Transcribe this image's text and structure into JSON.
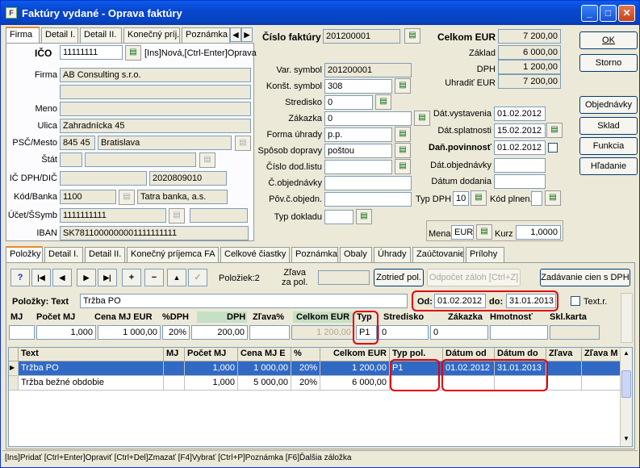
{
  "window": {
    "title": "Faktúry vydané - Oprava faktúry",
    "min": "_",
    "max": "□",
    "close": "✕"
  },
  "top_tabs": [
    "Firma",
    "Detail I.",
    "Detail II.",
    "Konečný príj.",
    "Poznámka"
  ],
  "firma": {
    "ico_label": "IČO",
    "ico": "11111111",
    "ico_hint": "[Ins]Nová,[Ctrl-Enter]Oprava",
    "firma_label": "Firma",
    "firma": "AB Consulting s.r.o.",
    "meno_label": "Meno",
    "ulica_label": "Ulica",
    "ulica": "Zahradnícka 45",
    "psc_label": "PSČ/Mesto",
    "psc": "845 45",
    "mesto": "Bratislava",
    "stat_label": "Štát",
    "icdph_label": "IČ DPH/DIČ",
    "dic": "2020809010",
    "kod_label": "Kód/Banka",
    "kod": "1100",
    "banka": "Tatra banka, a.s.",
    "ucet_label": "Účet/ŠSymb",
    "ucet": "1111111111",
    "iban_label": "IBAN",
    "iban": "SK7811000000001111111111"
  },
  "mid": {
    "cislo_label": "Číslo faktúry",
    "cislo": "201200001",
    "var_label": "Var. symbol",
    "var": "201200001",
    "konst_label": "Konšt. symbol",
    "konst": "308",
    "stred_label": "Stredisko",
    "stred": "0",
    "zak_label": "Zákazka",
    "zak": "0",
    "forma_label": "Forma úhrady",
    "forma": "p.p.",
    "sposob_label": "Spôsob dopravy",
    "sposob": "poštou",
    "dod_label": "Číslo dod.listu",
    "obj_label": "Č.objednávky",
    "povc_label": "Pôv.č.objedn.",
    "typ_label": "Typ dokladu"
  },
  "right": {
    "celkom_label": "Celkom EUR",
    "celkom": "7 200,00",
    "zaklad_label": "Základ",
    "zaklad": "6 000,00",
    "dph_label": "DPH",
    "dph": "1 200,00",
    "uhradit_label": "Uhradiť EUR",
    "uhradit": "7 200,00",
    "vyst_label": "Dát.vystavenia",
    "vyst": "01.02.2012",
    "splat_label": "Dát.splatnosti",
    "splat": "15.02.2012",
    "danpov_label": "Daň.povinnosť",
    "danpov": "01.02.2012",
    "datobj_label": "Dát.objednávky",
    "datdod_label": "Dátum dodania",
    "typdph_label": "Typ DPH",
    "typdph": "10",
    "kodpl_label": "Kód plnen.",
    "mena_label": "Mena",
    "mena": "EUR",
    "kurz_label": "Kurz",
    "kurz": "1,0000"
  },
  "side_buttons": [
    "OK",
    "Storno",
    "Objednávky",
    "Sklad",
    "Funkcia",
    "Hľadanie"
  ],
  "item_tabs": [
    "Položky",
    "Detail I.",
    "Detail II.",
    "Konečný príjemca FA",
    "Celkové čiastky",
    "Poznámka",
    "Obaly",
    "Úhrady",
    "Zaúčtovanie",
    "Prílohy"
  ],
  "toolbar": {
    "help": "?",
    "first": "|◀",
    "prev": "◀",
    "next": "▶",
    "last": "▶|",
    "add": "+",
    "del": "−",
    "up": "▲",
    "check": "✓",
    "count": "Položiek:2",
    "zlava_pol": "Zľava\nza pol.",
    "sort": "Zotrieď pol.",
    "odpocet": "Odpočet záloh [Ctrl+Z]",
    "zadav": "Zadávanie cien s DPH"
  },
  "edit": {
    "pol_label": "Položky: Text",
    "text": "Tržba PO",
    "od_label": "Od:",
    "od": "01.02.2012",
    "do_label": "do:",
    "do": "31.01.2013",
    "textr": "Text.r.",
    "headers": [
      "MJ",
      "Počet MJ",
      "Cena MJ EUR",
      "%DPH",
      "DPH",
      "Zľava%",
      "Celkom EUR",
      "Typ",
      "Stredisko",
      "Zákazka",
      "Hmotnosť",
      "Skl.karta"
    ],
    "pocet": "1,000",
    "cena": "1 000,00",
    "pdph": "20%",
    "dph": "200,00",
    "celkom": "1 200,00",
    "typ": "P1",
    "stred": "0",
    "zak": "0"
  },
  "grid": {
    "headers": [
      "Text",
      "MJ",
      "Počet MJ",
      "Cena MJ E",
      "%",
      "Celkom EUR",
      "Typ pol.",
      "Dátum od",
      "Dátum do",
      "Zľava",
      "Zľava M"
    ],
    "rows": [
      [
        "Tržba PO",
        "",
        "1,000",
        "1 000,00",
        "20%",
        "1 200,00",
        "P1",
        "01.02.2012",
        "31.01.2013",
        "",
        ""
      ],
      [
        "Tržba bežné obdobie",
        "",
        "1,000",
        "5 000,00",
        "20%",
        "6 000,00",
        "",
        "",
        "",
        "",
        ""
      ]
    ]
  },
  "status": "[Ins]Pridať [Ctrl+Enter]Opraviť [Ctrl+Del]Zmazať [F4]Vybrať [Ctrl+P]Poznámka [F6]Ďalšia záložka"
}
